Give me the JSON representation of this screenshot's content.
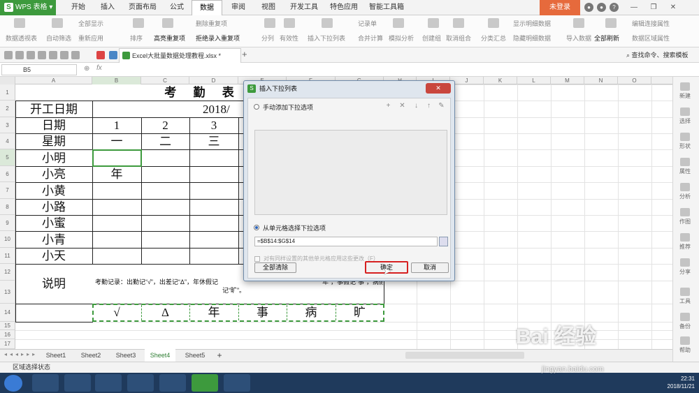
{
  "app": {
    "name": "WPS 表格",
    "logo_glyph": "S",
    "login": "未登录"
  },
  "menu_tabs": [
    "开始",
    "插入",
    "页面布局",
    "公式",
    "数据",
    "审阅",
    "视图",
    "开发工具",
    "特色应用",
    "智能工具箱"
  ],
  "active_tab": "数据",
  "ribbon": {
    "buttons": [
      "数据透视表",
      "自动筛选",
      "全部显示",
      "重新应用",
      "排序",
      "高亮重复项",
      "删除重复项",
      "拒绝录入重复项",
      "分列",
      "有效性",
      "插入下拉列表",
      "记录单",
      "合并计算",
      "模拟分析",
      "创建组",
      "取消组合",
      "分类汇总",
      "显示明细数据",
      "隐藏明细数据",
      "导入数据",
      "全部刷新",
      "编辑连接属性",
      "数据区域属性"
    ]
  },
  "document": {
    "tab_title": "Excel大批量数据处理教程.xlsx *",
    "add_tab": "+"
  },
  "search": {
    "label": "查找命令、搜索模板"
  },
  "formula": {
    "cell_ref": "B5",
    "fx": "fx"
  },
  "columns": [
    "A",
    "B",
    "C",
    "D",
    "E",
    "F",
    "G",
    "H",
    "I",
    "J",
    "K",
    "L",
    "M",
    "N",
    "O"
  ],
  "rows": [
    "1",
    "2",
    "3",
    "4",
    "5",
    "6",
    "7",
    "8",
    "9",
    "10",
    "11",
    "12",
    "13",
    "14",
    "15",
    "16",
    "17"
  ],
  "sheet": {
    "title": "考 勤 表",
    "start_label": "开工日期",
    "start_value": "2018/",
    "date_label": "日期",
    "dates": [
      "1",
      "2",
      "3"
    ],
    "week_label": "星期",
    "weekdays": [
      "一",
      "二",
      "三"
    ],
    "names": [
      "小明",
      "小亮",
      "小黄",
      "小路",
      "小蜜",
      "小青",
      "小天"
    ],
    "b6_value": "年",
    "note_label": "说明",
    "note_line1": "考勤记录：出勤记“√”，出差记“Δ”，年休假记",
    "note_line1_tail": "“年”，事假记“事”，病假记“病”，旷工",
    "note_line2": "记“旷”。",
    "symbols": [
      "√",
      "Δ",
      "年",
      "事",
      "病",
      "旷"
    ]
  },
  "sheet_tabs": [
    "Sheet1",
    "Sheet2",
    "Sheet3",
    "Sheet4",
    "Sheet5"
  ],
  "active_sheet": "Sheet4",
  "status": {
    "text": "区域选择状态"
  },
  "right_panel": [
    "新建",
    "选择",
    "形状",
    "属性",
    "分析",
    "作图",
    "推荐",
    "分享",
    "工具",
    "备份",
    "帮助"
  ],
  "dialog": {
    "title": "插入下拉列表",
    "close": "✕",
    "opt_manual": "手动添加下拉选项",
    "opt_cells": "从单元格选择下拉选项",
    "range": "=$B$14:$G$14",
    "apply_all": "对有同样设置的其他单元格应用这些更改（F）",
    "clear_all": "全部清除",
    "ok": "确定",
    "cancel": "取消"
  },
  "watermark": {
    "text": "Bai 经验",
    "url": "jingyan.baidu.com"
  },
  "clock": {
    "time": "22:31",
    "date": "2018/11/21"
  },
  "colors": {
    "brand_green": "#3d9a3d",
    "login_orange": "#e66a3c",
    "ok_highlight": "#d62020",
    "taskbar": "#1f3a5c"
  }
}
